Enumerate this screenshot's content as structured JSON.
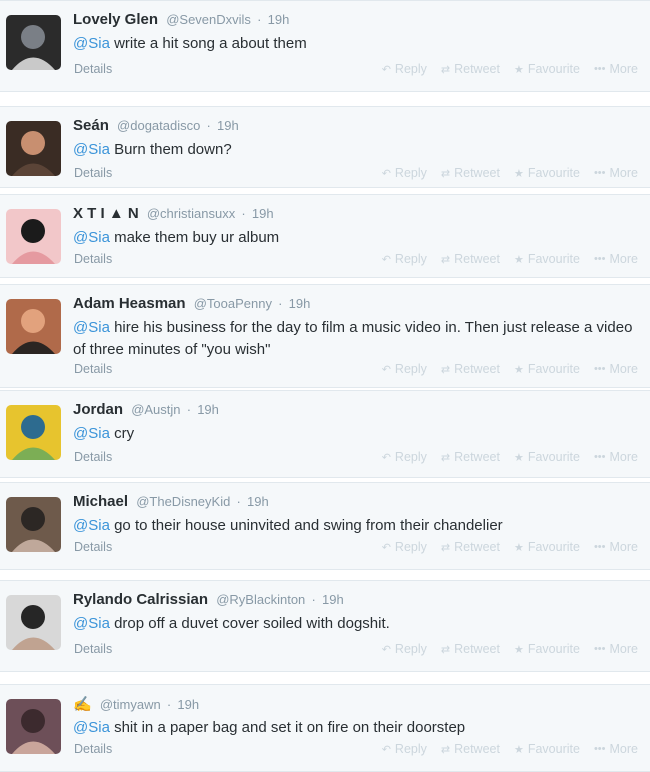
{
  "action_labels": {
    "reply": "Reply",
    "retweet": "Retweet",
    "favourite": "Favourite",
    "more": "More"
  },
  "details_label": "Details",
  "tweets": [
    {
      "name": "Lovely Glen",
      "handle": "@SevenDxvils",
      "sep": "·",
      "time": "19h",
      "mention": "@Sia",
      "text": " write a hit song a about them",
      "avatar_colors": [
        "#2b2b2b",
        "#7a7f86",
        "#c9c9c9"
      ]
    },
    {
      "name": "Seán",
      "handle": "@dogatadisco",
      "sep": "·",
      "time": "19h",
      "mention": "@Sia",
      "text": " Burn them down?",
      "avatar_colors": [
        "#3a2c24",
        "#c88f70",
        "#5b4437"
      ]
    },
    {
      "name": "X T I ▲ N",
      "handle": "@christiansuxx",
      "sep": "·",
      "time": "19h",
      "mention": "@Sia",
      "text": " make them buy ur album",
      "avatar_colors": [
        "#f2c7c9",
        "#1b1b1b",
        "#e59aa0"
      ]
    },
    {
      "name": "Adam Heasman",
      "handle": "@TooaPenny",
      "sep": "·",
      "time": "19h",
      "mention": "@Sia",
      "text": " hire his business for the day to film a music video in. Then just release a video of three minutes of \"you wish\"",
      "avatar_colors": [
        "#b06a4a",
        "#e2a27d",
        "#2b2522"
      ]
    },
    {
      "name": "Jordan",
      "handle": "@Austjn",
      "sep": "·",
      "time": "19h",
      "mention": "@Sia",
      "text": " cry",
      "avatar_colors": [
        "#e7c42e",
        "#2d6b8f",
        "#7cae55"
      ]
    },
    {
      "name": "Michael",
      "handle": "@TheDisneyKid",
      "sep": "·",
      "time": "19h",
      "mention": "@Sia",
      "text": " go to their house uninvited and swing from their chandelier",
      "avatar_colors": [
        "#6e5a4b",
        "#2c2724",
        "#bfa89a"
      ]
    },
    {
      "name": "Rylando Calrissian",
      "handle": "@RyBlackinton",
      "sep": "·",
      "time": "19h",
      "mention": "@Sia",
      "text": " drop off a duvet cover soiled with dogshit.",
      "avatar_colors": [
        "#d8d8d8",
        "#262626",
        "#c0a391"
      ]
    },
    {
      "name": "✍",
      "handle": "@timyawn",
      "sep": "·",
      "time": "19h",
      "mention": "@Sia",
      "text": " shit in a paper bag and set it on fire on their doorstep",
      "avatar_colors": [
        "#6d4f58",
        "#3c2a2e",
        "#c9a59b"
      ]
    }
  ]
}
